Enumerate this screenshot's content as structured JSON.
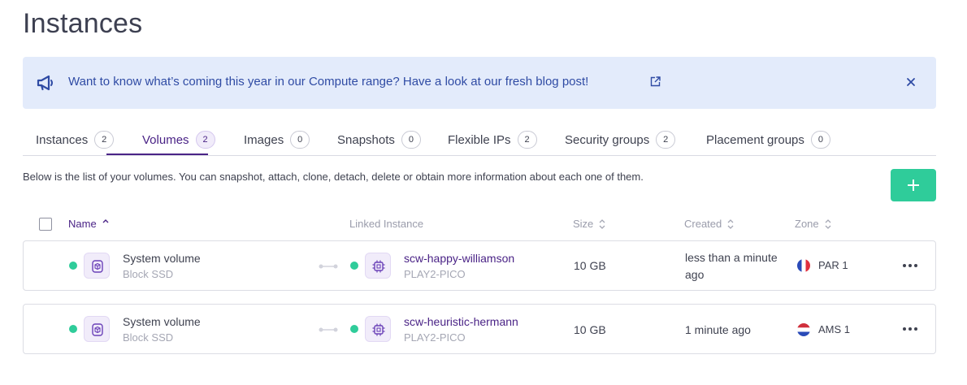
{
  "page": {
    "title": "Instances"
  },
  "banner": {
    "text": "Want to know what’s coming this year in our Compute range? Have a look at our fresh blog post!",
    "icon": "megaphone-icon",
    "link_icon": "external-link-icon",
    "close_icon": "close-icon",
    "color": "#e3ebfb"
  },
  "tabs": [
    {
      "label": "Instances",
      "count": "2",
      "active": false
    },
    {
      "label": "Volumes",
      "count": "2",
      "active": true
    },
    {
      "label": "Images",
      "count": "0",
      "active": false
    },
    {
      "label": "Snapshots",
      "count": "0",
      "active": false
    },
    {
      "label": "Flexible IPs",
      "count": "2",
      "active": false
    },
    {
      "label": "Security groups",
      "count": "2",
      "active": false
    },
    {
      "label": "Placement groups",
      "count": "0",
      "active": false
    }
  ],
  "description": "Below is the list of your volumes. You can snapshot, attach, clone, detach, delete or obtain more information about each one of them.",
  "add_button": {
    "icon": "plus-icon",
    "color": "#2fcc9a"
  },
  "table": {
    "columns": {
      "name": "Name",
      "linked": "Linked Instance",
      "size": "Size",
      "created": "Created",
      "zone": "Zone"
    },
    "rows": [
      {
        "name": "System volume",
        "type": "Block SSD",
        "instance": "scw-happy-williamson",
        "instance_type": "PLAY2-PICO",
        "size": "10 GB",
        "created_line1": "less than a minute",
        "created_line2": "ago",
        "zone": "PAR 1",
        "flag": "france-flag-icon"
      },
      {
        "name": "System volume",
        "type": "Block SSD",
        "instance": "scw-heuristic-hermann",
        "instance_type": "PLAY2-PICO",
        "size": "10 GB",
        "created_line1": "1 minute ago",
        "created_line2": "",
        "zone": "AMS 1",
        "flag": "netherlands-flag-icon"
      }
    ]
  },
  "colors": {
    "accent": "#4a2386",
    "status_ok": "#2fcc9a"
  }
}
